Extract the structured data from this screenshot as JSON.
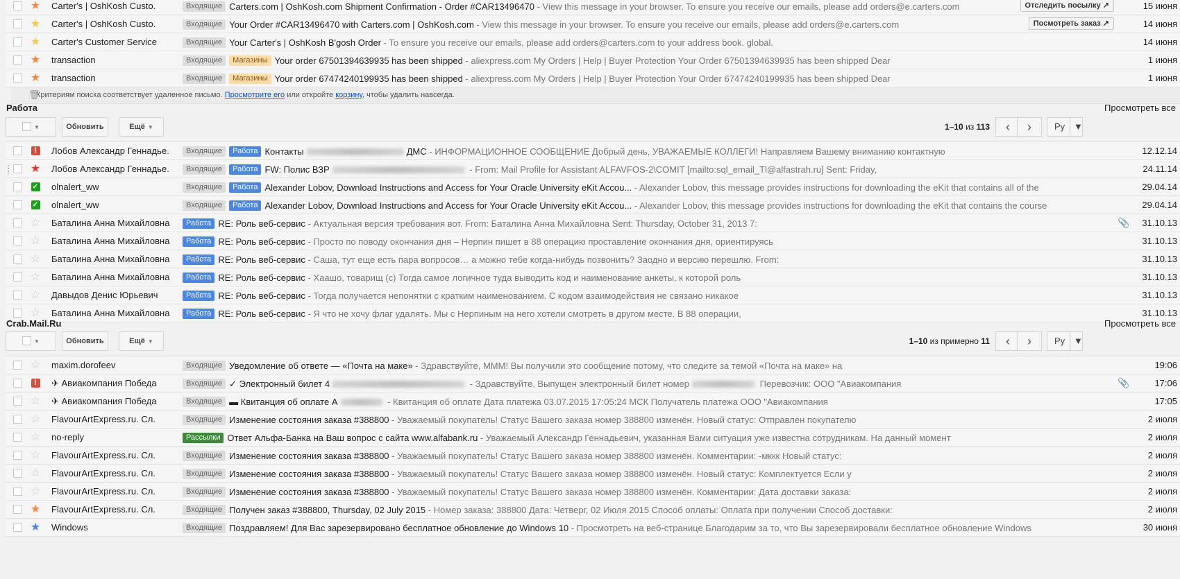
{
  "section1": {
    "rows": [
      {
        "sender": "Carter's | OshKosh Custo.",
        "label": "Входящие",
        "subject": "Carters.com | OshKosh.com Shipment Confirmation - Order #CAR13496470",
        "snippet": " - View this message in your browser. To ensure you receive our emails, please add orders@e.carters.com",
        "action": "Отследить посылку ↗",
        "date": "15 июня"
      },
      {
        "sender": "Carter's | OshKosh Custo.",
        "label": "Входящие",
        "subject": "Your Order #CAR13496470 with Carters.com | OshKosh.com",
        "snippet": " - View this message in your browser. To ensure you receive our emails, please add orders@e.carters.com",
        "action": "Посмотреть заказ ↗",
        "date": "14 июня"
      },
      {
        "sender": "Carter's Customer Service",
        "label": "Входящие",
        "subject": "Your Carter's | OshKosh B'gosh Order",
        "snippet": " - To ensure you receive our emails, please add orders@carters.com to your address book. global.",
        "date": "14 июня"
      },
      {
        "sender": "transaction",
        "label": "Входящие",
        "label2": "Магазины",
        "subject": "Your order 67501394639935 has been shipped",
        "snippet": " - aliexpress.com My Orders | Help | Buyer Protection Your Order 67501394639935 has been shipped Dear",
        "date": "1 июня"
      },
      {
        "sender": "transaction",
        "label": "Входящие",
        "label2": "Магазины",
        "subject": "Your order 67474240199935 has been shipped",
        "snippet": " - aliexpress.com My Orders | Help | Buyer Protection Your Order 67474240199935 has been shipped Dear",
        "date": "1 июня"
      }
    ],
    "notice": {
      "text1": "Критериям поиска соответствует удаленное письмо.",
      "link1": "Просмотрите его",
      "text2": "или откройте",
      "link2": "корзину",
      "text3": ", чтобы удалить навсегда."
    }
  },
  "section2": {
    "title": "Работа",
    "view_all": "Просмотреть все",
    "refresh": "Обновить",
    "more": "Ещё",
    "pager_range": "1–10",
    "pager_of": "из",
    "pager_total": "113",
    "lang": "Ру",
    "rows": [
      {
        "sender": "Лобов Александр Геннадье.",
        "label": "Входящие",
        "label2": "Работа",
        "subject": "Контакты",
        "subject_tail": "ДМС",
        "snippet": " - ИНФОРМАЦИОННОЕ СООБЩЕНИЕ Добрый день, УВАЖАЕМЫЕ КОЛЛЕГИ! Направляем Вашему вниманию контактную",
        "date": "12.12.14"
      },
      {
        "sender": "Лобов Александр Геннадье.",
        "label": "Входящие",
        "label2": "Работа",
        "subject": "FW: Полис ВЗР",
        "snippet": " - From: Mail Profile for Assistant ALFAVFOS-2\\COMIT [mailto:sql_email_Tl@alfastrah.ru] Sent: Friday,",
        "date": "24.11.14"
      },
      {
        "sender": "olnalert_ww",
        "label": "Входящие",
        "label2": "Работа",
        "subject": "Alexander Lobov, Download Instructions and Access for Your Oracle University eKit Accou...",
        "snippet": " - Alexander Lobov, this message provides instructions for downloading the eKit that contains all of the",
        "date": "29.04.14"
      },
      {
        "sender": "olnalert_ww",
        "label": "Входящие",
        "label2": "Работа",
        "subject": "Alexander Lobov, Download Instructions and Access for Your Oracle University eKit Accou...",
        "snippet": " - Alexander Lobov, this message provides instructions for downloading the eKit that contains the course",
        "date": "29.04.14"
      },
      {
        "sender": "Баталина Анна Михайловна",
        "label2": "Работа",
        "subject": "RE: Роль веб-сервис",
        "snippet": " - Актуальная версия требования вот. From: Баталина Анна Михайловна Sent: Thursday, October 31, 2013 7:",
        "date": "31.10.13"
      },
      {
        "sender": "Баталина Анна Михайловна",
        "label2": "Работа",
        "subject": "RE: Роль веб-сервис",
        "snippet": " - Просто по поводу окончания дня – Нерпин пишет в 88 операцию проставление окончания дня, ориентируясь",
        "date": "31.10.13"
      },
      {
        "sender": "Баталина Анна Михайловна",
        "label2": "Работа",
        "subject": "RE: Роль веб-сервис",
        "snippet": " - Саша, тут еще есть пара вопросов… а можно тебе когда-нибудь позвонить? Заодно и версию перешлю. From:",
        "date": "31.10.13"
      },
      {
        "sender": "Баталина Анна Михайловна",
        "label2": "Работа",
        "subject": "RE: Роль веб-сервис",
        "snippet": " - Хаашо, товарищ (с) Тогда самое логичное туда выводить код и наименование анкеты, к которой роль",
        "date": "31.10.13"
      },
      {
        "sender": "Давыдов Денис Юрьевич",
        "label2": "Работа",
        "subject": "RE: Роль веб-сервис",
        "snippet": " - Тогда получается непонятки с кратким наименованием. С кодом взаимодействия не связано никакое",
        "date": "31.10.13"
      },
      {
        "sender": "Баталина Анна Михайловна",
        "label2": "Работа",
        "subject": "RE: Роль веб-сервис",
        "snippet": " - Я что не хочу флаг удалять. Мы с Нерпиным на него хотели смотреть в другом месте. В 88 операции,",
        "date": "31.10.13"
      }
    ]
  },
  "section3": {
    "title": "Crab.Mail.Ru",
    "view_all": "Просмотреть все",
    "refresh": "Обновить",
    "more": "Ещё",
    "pager_range": "1–10",
    "pager_of": "из примерно",
    "pager_total": "11",
    "lang": "Ру",
    "rows": [
      {
        "sender": "maxim.dorofeev",
        "label": "Входящие",
        "subject": "Уведомление об ответе — «Почта на маке»",
        "snippet": " - Здравствуйте, МММ! Вы получили это сообщение потому, что следите за темой «Почта на маке» на",
        "date": "19:06"
      },
      {
        "sender": "✈ Авиакомпания Победа",
        "label": "Входящие",
        "subject": "✓ Электронный билет 4",
        "snippet": " - Здравствуйте, Выпущен электронный билет номер",
        "snippet_tail": " Перевозчик: ООО \"Авиакомпания",
        "date": "17:06"
      },
      {
        "sender": "✈ Авиакомпания Победа",
        "label": "Входящие",
        "subject": "▬ Квитанция об оплате А",
        "snippet": " - Квитанция об оплате Дата платежа 03.07.2015 17:05:24 МСК Получатель платежа ООО \"Авиакомпания",
        "date": "17:05"
      },
      {
        "sender": "FlavourArtExpress.ru. Сл.",
        "label": "Входящие",
        "subject": "Изменение состояния заказа #388800",
        "snippet": " - Уважаемый покупатель! Статус Вашего заказа номер 388800 изменён. Новый статус: Отправлен покупателю",
        "date": "2 июля"
      },
      {
        "sender": "no-reply",
        "label": "Рассылки",
        "subject": "Ответ Альфа-Банка на Ваш вопрос с сайта www.alfabank.ru",
        "snippet": " - Уважаемый Александр Геннадьевич, указанная Вами ситуация уже известна сотрудникам. На данный момент",
        "date": "2 июля"
      },
      {
        "sender": "FlavourArtExpress.ru. Сл.",
        "label": "Входящие",
        "subject": "Изменение состояния заказа #388800",
        "snippet": " - Уважаемый покупатель! Статус Вашего заказа номер 388800 изменён. Комментарии: -мккк Новый статус:",
        "date": "2 июля"
      },
      {
        "sender": "FlavourArtExpress.ru. Сл.",
        "label": "Входящие",
        "subject": "Изменение состояния заказа #388800",
        "snippet": " - Уважаемый покупатель! Статус Вашего заказа номер 388800 изменён. Новый статус: Комплектуется Если у",
        "date": "2 июля"
      },
      {
        "sender": "FlavourArtExpress.ru. Сл.",
        "label": "Входящие",
        "subject": "Изменение состояния заказа #388800",
        "snippet": " - Уважаемый покупатель! Статус Вашего заказа номер 388800 изменён. Комментарии: Дата доставки заказа:",
        "date": "2 июля"
      },
      {
        "sender": "FlavourArtExpress.ru. Сл.",
        "label": "Входящие",
        "subject": "Получен заказ #388800, Thursday, 02 July 2015",
        "snippet": " - Номер заказа: 388800 Дата: Четверг, 02 Июля 2015 Способ оплаты: Оплата при получении Способ доставки:",
        "date": "2 июля"
      },
      {
        "sender": "Windows",
        "label": "Входящие",
        "subject": "Поздравляем! Для Вас зарезервировано бесплатное обновление до Windows 10",
        "snippet": " - Просмотреть на веб-странице Благодарим за то, что Вы зарезервировали бесплатное обновление Windows",
        "date": "30 июня"
      }
    ]
  },
  "colors": {
    "work_label": "#4986e7",
    "news_label": "#3d8a3b",
    "shop_label": "#fcdba8",
    "star_orange": "#f6893b",
    "star_yellow": "#f7c843",
    "star_red": "#e8352a",
    "star_blue": "#4b83e5",
    "important_red": "#dd4b39",
    "check_green": "#17a316"
  },
  "icons": {
    "star": "star-icon",
    "important": "important-marker-icon",
    "check": "check-marker-icon",
    "trash": "trash-icon",
    "attachment": "paperclip-icon",
    "prev": "chevron-left-icon",
    "next": "chevron-right-icon",
    "dropdown": "caret-down-icon"
  }
}
